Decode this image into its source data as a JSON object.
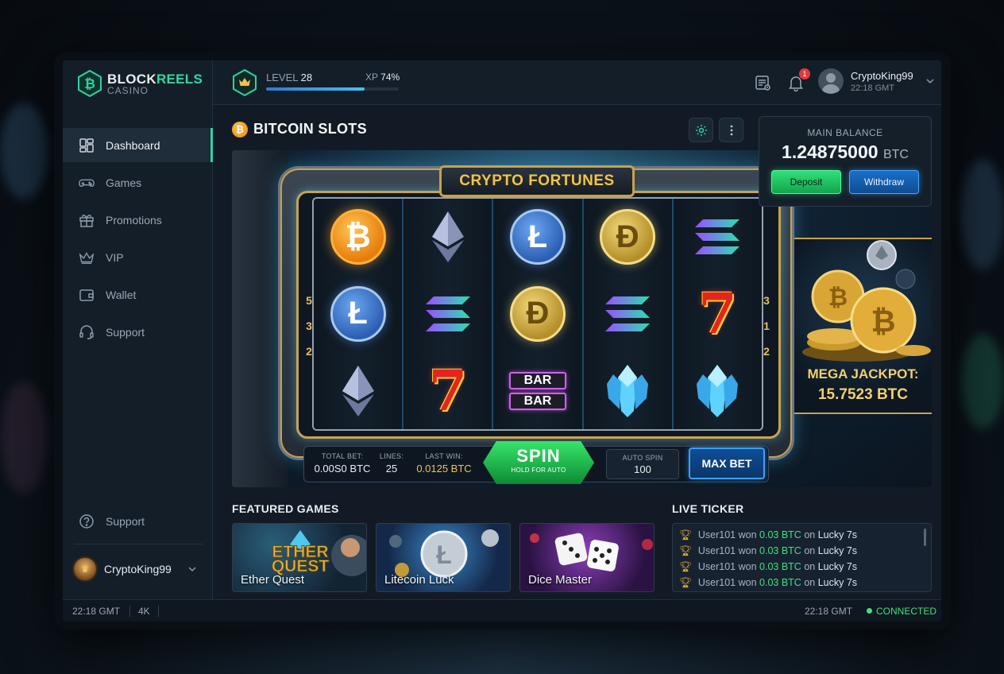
{
  "brand": {
    "name_part1": "BLOCK",
    "name_part2": "REELS",
    "subtitle": "CASINO"
  },
  "sidebar": {
    "items": [
      {
        "label": "Dashboard",
        "icon": "dashboard-icon",
        "active": true
      },
      {
        "label": "Games",
        "icon": "gamepad-icon"
      },
      {
        "label": "Promotions",
        "icon": "gift-icon"
      },
      {
        "label": "VIP",
        "icon": "crown-icon"
      },
      {
        "label": "Wallet",
        "icon": "wallet-icon"
      },
      {
        "label": "Support",
        "icon": "headset-icon"
      }
    ],
    "support_label": "Support",
    "user": {
      "name": "CryptoKing99"
    }
  },
  "topbar": {
    "level_label": "LEVEL",
    "level_value": "28",
    "xp_label": "XP",
    "xp_value": "74%",
    "xp_progress": 0.74,
    "notification_count": "1",
    "user": {
      "name": "CryptoKing99",
      "time": "22:18 GMT"
    }
  },
  "page": {
    "title": "BITCOIN SLOTS"
  },
  "balance": {
    "label": "MAIN BALANCE",
    "amount": "1.24875000",
    "currency": "BTC",
    "deposit_label": "Deposit",
    "withdraw_label": "Withdraw"
  },
  "slot": {
    "machine_title": "CRYPTO FORTUNES",
    "paylines_left": [
      "5",
      "3",
      "2"
    ],
    "paylines_right": [
      "3",
      "1",
      "2"
    ],
    "reels": [
      [
        "bitcoin",
        "litecoin",
        "ethereum"
      ],
      [
        "ethereum",
        "solana",
        "seven"
      ],
      [
        "litecoin",
        "dogecoin",
        "bar"
      ],
      [
        "dogecoin",
        "solana",
        "diamond"
      ],
      [
        "solana",
        "seven",
        "diamond"
      ]
    ],
    "bar_text": "BAR",
    "controls": {
      "total_bet_label": "TOTAL BET:",
      "total_bet_value": "0.00S0 BTC",
      "lines_label": "LINES:",
      "lines_value": "25",
      "last_win_label": "LAST WIN:",
      "last_win_value": "0.0125 BTC",
      "spin_label": "SPIN",
      "spin_hint": "HOLD FOR AUTO",
      "auto_spin_label": "AUTO SPIN",
      "auto_spin_value": "100",
      "max_bet_label": "MAX BET"
    },
    "jackpot": {
      "label": "MEGA JACKPOT:",
      "value": "15.7523 BTC"
    }
  },
  "featured": {
    "title": "FEATURED GAMES",
    "games": [
      {
        "label": "Ether Quest",
        "art_text_1": "ETHER",
        "art_text_2": "QUEST"
      },
      {
        "label": "Litecoin Luck"
      },
      {
        "label": "Dice Master"
      }
    ]
  },
  "ticker": {
    "title": "LIVE TICKER",
    "rows": [
      {
        "user": "User101 won",
        "amount": "0.03 BTC",
        "on": "on",
        "game": "Lucky 7s"
      },
      {
        "user": "User101 won",
        "amount": "0.03 BTC",
        "on": "on",
        "game": "Lucky 7s"
      },
      {
        "user": "User101 won",
        "amount": "0.03 BTC",
        "on": "on",
        "game": "Lucky 7s"
      },
      {
        "user": "User101 won",
        "amount": "0.03 BTC",
        "on": "on",
        "game": "Lucky 7s"
      }
    ]
  },
  "statusbar": {
    "time_left": "22:18 GMT",
    "resolution": "4K",
    "time_right": "22:18 GMT",
    "connection": "CONNECTED"
  },
  "colors": {
    "accent": "#2ed3a0",
    "gold": "#f4c440",
    "success": "#3fe07f",
    "primary": "#3aa0ff"
  }
}
